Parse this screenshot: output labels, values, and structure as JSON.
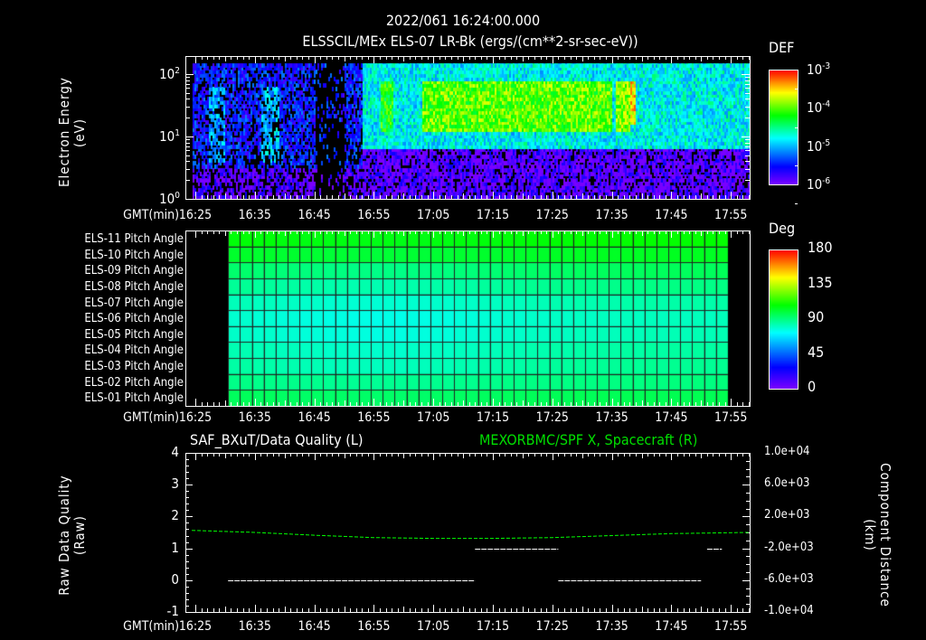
{
  "header": {
    "timestamp": "2022/061 16:24:00.000",
    "title": "ELSSCIL/MEx ELS-07 LR-Bk  (ergs/(cm**2-sr-sec-eV))"
  },
  "time_axis": {
    "label": "GMT(min)",
    "ticks": [
      "16:25",
      "16:35",
      "16:45",
      "16:55",
      "17:05",
      "17:15",
      "17:25",
      "17:35",
      "17:45",
      "17:55"
    ]
  },
  "chart_data": [
    {
      "type": "heatmap",
      "title": "ELSSCIL/MEx ELS-07 LR-Bk  (ergs/(cm**2-sr-sec-eV))",
      "ylabel": "Electron Energy",
      "ylabel_units": "(eV)",
      "yscale": "log",
      "ylim": [
        1,
        190
      ],
      "y_ticks": [
        {
          "base": "10",
          "exp": "0"
        },
        {
          "base": "10",
          "exp": "1"
        },
        {
          "base": "10",
          "exp": "2"
        }
      ],
      "colorbar": {
        "label": "DEF",
        "scale": "log",
        "range": [
          1e-06,
          0.001
        ],
        "ticks": [
          {
            "base": "10",
            "exp": "-3"
          },
          {
            "base": "10",
            "exp": "-4"
          },
          {
            "base": "10",
            "exp": "-5"
          },
          {
            "base": "10",
            "exp": "-6"
          }
        ]
      },
      "xlim_minutes_after_1600": [
        24.4,
        118.2
      ],
      "regions": [
        {
          "t": [
            24.4,
            53
          ],
          "e": [
            3,
            150
          ],
          "log_def": -5.5,
          "note": "sparse/patchy"
        },
        {
          "t": [
            27,
            30
          ],
          "e": [
            4,
            60
          ],
          "log_def": -5.1
        },
        {
          "t": [
            36,
            39
          ],
          "e": [
            4,
            60
          ],
          "log_def": -5.0
        },
        {
          "t": [
            53,
            118
          ],
          "e": [
            6.5,
            190
          ],
          "log_def": -4.8
        },
        {
          "t": [
            56,
            58
          ],
          "e": [
            12,
            80
          ],
          "log_def": -4.2
        },
        {
          "t": [
            63,
            95
          ],
          "e": [
            12,
            80
          ],
          "log_def": -4.0
        },
        {
          "t": [
            95.5,
            98
          ],
          "e": [
            12,
            80
          ],
          "log_def": -3.9
        },
        {
          "t": [
            98,
            99
          ],
          "e": [
            15,
            80
          ],
          "log_def": -3.5
        },
        {
          "t": [
            24.4,
            118
          ],
          "e": [
            1,
            6.5
          ],
          "log_def": -5.9
        }
      ]
    },
    {
      "type": "heatmap",
      "title": "Pitch Angle",
      "rows": [
        "ELS-11 Pitch Angle",
        "ELS-10 Pitch Angle",
        "ELS-09 Pitch Angle",
        "ELS-08 Pitch Angle",
        "ELS-07 Pitch Angle",
        "ELS-06 Pitch Angle",
        "ELS-05 Pitch Angle",
        "ELS-04 Pitch Angle",
        "ELS-03 Pitch Angle",
        "ELS-02 Pitch Angle",
        "ELS-01 Pitch Angle"
      ],
      "row_mean_deg": [
        108,
        103,
        95,
        89,
        84,
        81,
        82,
        85,
        87,
        90,
        96
      ],
      "data_time_range_minutes_after_1600": [
        30.5,
        114.5
      ],
      "column_step_minutes": 2,
      "dip_deg": 6,
      "dip_center_minutes_after_1600": 55,
      "colorbar": {
        "label": "Deg",
        "range": [
          0,
          180
        ],
        "ticks": [
          "180",
          "135",
          "90",
          "45",
          "0"
        ]
      }
    },
    {
      "type": "line",
      "left_title": "SAF_BXuT/Data Quality (L)",
      "right_title": "MEXORBMC/SPF X, Spacecraft (R)",
      "ylabel_left": "Raw Data Quality",
      "ylabel_left_units": "(Raw)",
      "ylabel_right": "Component Distance",
      "ylabel_right_units": "(km)",
      "ylim_left": [
        -1,
        4
      ],
      "ylim_right": [
        -10000,
        10000
      ],
      "left_ticks": [
        "4",
        "3",
        "2",
        "1",
        "0",
        "-1"
      ],
      "right_ticks": [
        "1.0e+04",
        "6.0e+03",
        "2.0e+03",
        "-2.0e+03",
        "-6.0e+03",
        "-1.0e+04"
      ],
      "series": [
        {
          "name": "Data Quality",
          "axis": "left",
          "color": "#ffffff",
          "segments": [
            {
              "t": [
                30.5,
                72
              ],
              "y": 0
            },
            {
              "t": [
                72,
                86
              ],
              "y": 1
            },
            {
              "t": [
                86,
                110
              ],
              "y": 0
            },
            {
              "t": [
                111,
                113.5
              ],
              "y": 1
            }
          ]
        },
        {
          "name": "SPF X, Spacecraft",
          "axis": "right",
          "color": "#00ff00",
          "x": [
            24.4,
            35,
            45,
            55,
            65,
            75,
            85,
            95,
            105,
            118
          ],
          "y": [
            260,
            0,
            -350,
            -650,
            -750,
            -750,
            -650,
            -400,
            -150,
            0
          ]
        }
      ]
    }
  ]
}
